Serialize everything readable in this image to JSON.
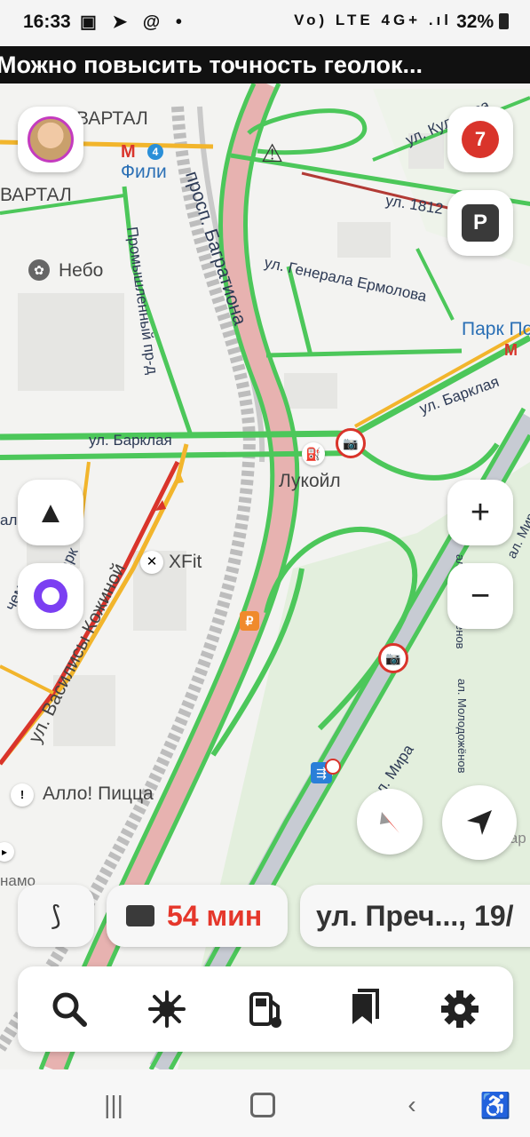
{
  "status_bar": {
    "time": "16:33",
    "left_icons": "▣ ➤ @ •",
    "network": "Vo) LTE 4G+ .ıl",
    "battery": "32%"
  },
  "banner": {
    "text": "Можно повысить точность геолок..."
  },
  "map_labels": {
    "kvartal_1": "ВАРТАЛ",
    "kvartal_2": "ВАРТАЛ",
    "metro_fili_line": "4",
    "metro_fili": "Фили",
    "nebo": "Небо",
    "bagrationa": "просп. Багратиона",
    "promyshlenny": "Промышленный пр-д",
    "kulneva": "ул. Кульнева",
    "ul_1812": "ул. 1812",
    "ermolova": "ул. Генерала Ермолова",
    "park_po": "Парк По",
    "barklaya_1": "ул. Барклая",
    "barklaya_2": "ул. Барклая",
    "lukoil": "Лукойл",
    "xfit": "XFit",
    "kozhinoy": "ул. Василисы Кожиной",
    "barklaya_side": "ул. Барк",
    "molodyozhenov_1": "ал. Молодожёнов",
    "molodyozhenov_2": "ал. Молодожёнов",
    "al_mira": "ал. Мира",
    "al_mira_2": "ал. Мира",
    "allo_pizza": "Алло! Пицца",
    "dinamo": "намо",
    "gar": "гар",
    "ruble_badge": "₽",
    "al": "ал",
    "chem": "чем"
  },
  "controls": {
    "traffic_score": "7",
    "parking_label": "P",
    "zoom_in": "+",
    "zoom_out": "−"
  },
  "route_info": {
    "time": "54 мин",
    "destination": "ул. Преч..., 19/"
  },
  "colors": {
    "traffic_green": "#4cc75a",
    "traffic_yellow": "#f2b52c",
    "traffic_red": "#d9342b",
    "route_pink": "#e7b2b0",
    "accent_red": "#e5372b"
  }
}
